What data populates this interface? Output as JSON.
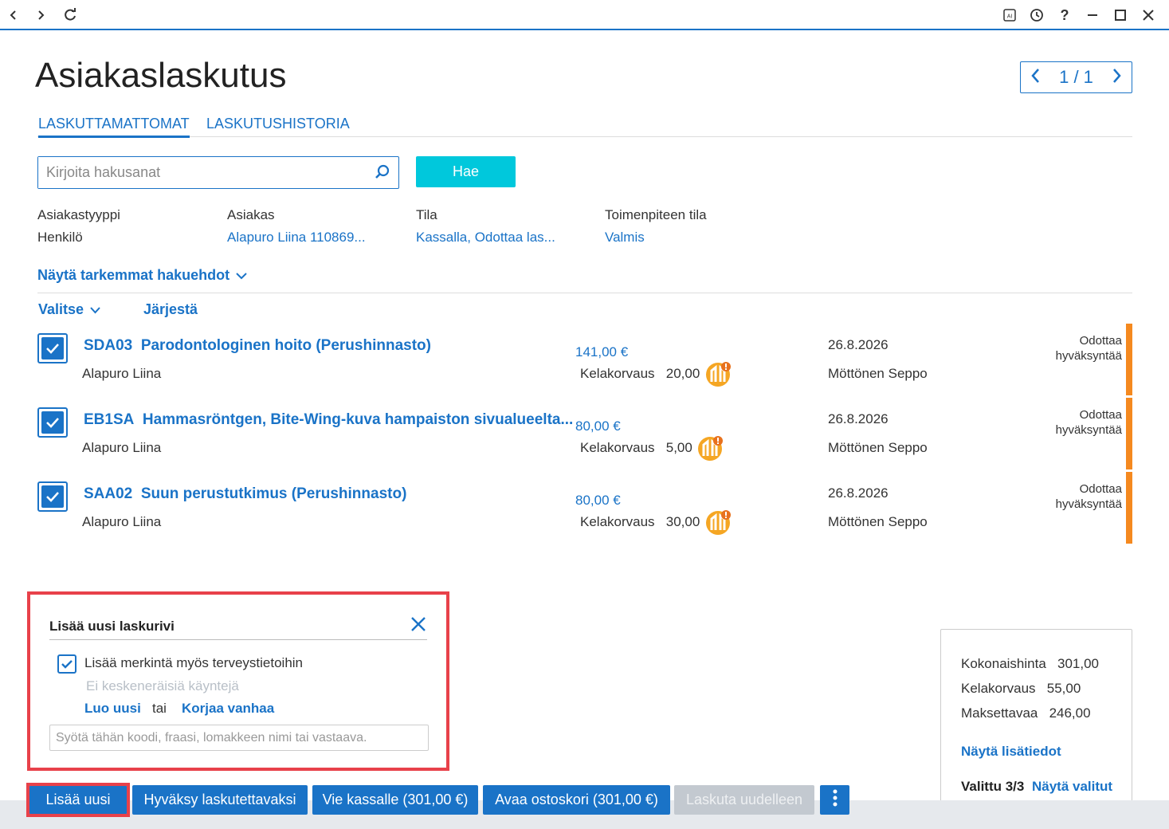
{
  "window": {
    "nav_back": "back",
    "nav_forward": "forward",
    "nav_refresh": "refresh",
    "ai_label": "AI",
    "help": "?"
  },
  "header": {
    "title": "Asiakaslaskutus",
    "pager": "1 / 1"
  },
  "tabs": [
    {
      "label": "LASKUTTAMATTOMAT",
      "active": true
    },
    {
      "label": "LASKUTUSHISTORIA",
      "active": false
    }
  ],
  "search": {
    "placeholder": "Kirjoita hakusanat",
    "button": "Hae"
  },
  "filters": [
    {
      "label": "Asiakastyyppi",
      "value": "Henkilö"
    },
    {
      "label": "Asiakas",
      "value": "Alapuro Liina 110869..."
    },
    {
      "label": "Tila",
      "value": "Kassalla, Odottaa las..."
    },
    {
      "label": "Toimenpiteen tila",
      "value": "Valmis"
    }
  ],
  "more_filters": "Näytä tarkemmat hakuehdot",
  "list_toolbar": {
    "select": "Valitse",
    "sort": "Järjestä"
  },
  "rows": [
    {
      "code": "SDA03",
      "title": "Parodontologinen hoito (Perushinnasto)",
      "patient": "Alapuro Liina",
      "price": "141,00 €",
      "kela_label": "Kelakorvaus",
      "kela_value": "20,00",
      "date": "26.8.2026",
      "doctor": "Möttönen Seppo",
      "status_line1": "Odottaa",
      "status_line2": "hyväksyntää",
      "checked": true
    },
    {
      "code": "EB1SA",
      "title": "Hammasröntgen, Bite-Wing-kuva hampaiston sivualueelta...",
      "patient": "Alapuro Liina",
      "price": "80,00 €",
      "kela_label": "Kelakorvaus",
      "kela_value": "5,00",
      "date": "26.8.2026",
      "doctor": "Möttönen Seppo",
      "status_line1": "Odottaa",
      "status_line2": "hyväksyntää",
      "checked": true
    },
    {
      "code": "SAA02",
      "title": "Suun perustutkimus (Perushinnasto)",
      "patient": "Alapuro Liina",
      "price": "80,00 €",
      "kela_label": "Kelakorvaus",
      "kela_value": "30,00",
      "date": "26.8.2026",
      "doctor": "Möttönen Seppo",
      "status_line1": "Odottaa",
      "status_line2": "hyväksyntää",
      "checked": true
    }
  ],
  "add_panel": {
    "title": "Lisää uusi laskurivi",
    "checkbox_label": "Lisää merkintä myös terveystietoihin",
    "muted_text": "Ei keskeneräisiä käyntejä",
    "link_new": "Luo uusi",
    "or_text": "tai",
    "link_fix": "Korjaa vanhaa",
    "input_placeholder": "Syötä tähän koodi, fraasi, lomakkeen nimi tai vastaava."
  },
  "summary": {
    "total_label": "Kokonaishinta",
    "total_value": "301,00",
    "kela_label": "Kelakorvaus",
    "kela_value": "55,00",
    "pay_label": "Maksettavaa",
    "pay_value": "246,00",
    "details_link": "Näytä lisätiedot",
    "selected_label": "Valittu 3/3",
    "selected_link": "Näytä valitut"
  },
  "actions": {
    "add_new": "Lisää uusi",
    "approve": "Hyväksy laskutettavaksi",
    "to_register": "Vie kassalle (301,00 €)",
    "open_cart": "Avaa ostoskori (301,00 €)",
    "rebill": "Laskuta uudelleen"
  },
  "colors": {
    "accent": "#1a73c7",
    "search_button": "#00c8dc",
    "status_bar": "#f5891f",
    "badge": "#f5a623",
    "highlight": "#e8414a"
  }
}
